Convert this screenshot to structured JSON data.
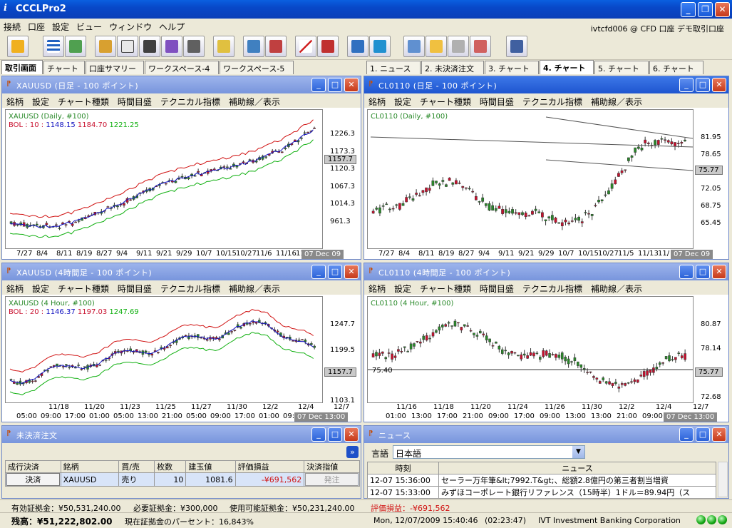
{
  "app": {
    "title": "CCCLPro2",
    "icon_glyph": "i",
    "account": "ivtcfd006 @ CFD 口座 デモ取引口座"
  },
  "menu": [
    "接続",
    "口座",
    "設定",
    "ビュー",
    "ウィンドウ",
    "ヘルプ"
  ],
  "left_tabs": [
    {
      "label": "取引画面",
      "active": true
    },
    {
      "label": "チャート"
    },
    {
      "label": "口座サマリー"
    },
    {
      "label": "ワークスペース-4"
    },
    {
      "label": "ワークスペース-5"
    }
  ],
  "right_tabs": [
    {
      "label": "1. ニュース"
    },
    {
      "label": "2. 未決済注文"
    },
    {
      "label": "3. チャート"
    },
    {
      "label": "4. チャート",
      "active": true
    },
    {
      "label": "5. チャート"
    },
    {
      "label": "6. チャート"
    }
  ],
  "chart_menu": [
    "銘柄",
    "設定",
    "チャート種類",
    "時間目盛",
    "テクニカル指標",
    "補助線／表示"
  ],
  "colors": {
    "up": "#2a8a2a",
    "down": "#c8102e",
    "bol_upper": "#d01010",
    "bol_mid": "#1010c0",
    "bol_lower": "#10b010"
  },
  "charts": [
    {
      "id": "c1",
      "title": "XAUUSD (日足 - 100 ポイント)",
      "legend": "XAUUSD (Daily, #100)",
      "bol_label": "BOL : 10 :",
      "bol_vals": [
        "1148.15",
        "1184.70",
        "1221.25"
      ],
      "yticks": [
        "1226.3",
        "1173.3",
        "1120.3",
        "1067.3",
        "1014.3",
        "961.3"
      ],
      "ylast": "1157.7",
      "xticks": [
        "7/27",
        "8/4",
        "8/11",
        "8/19",
        "8/27",
        "9/4",
        "9/11",
        "9/21",
        "9/29",
        "10/7",
        "10/15",
        "10/27",
        "11/6",
        "11/16",
        "11/"
      ],
      "date": "07 Dec 09"
    },
    {
      "id": "c2",
      "title": "CL0110 (日足 - 100 ポイント)",
      "legend": "CL0110 (Daily, #100)",
      "yticks": [
        "81.95",
        "78.65",
        "75.77",
        "72.05",
        "68.75",
        "65.45"
      ],
      "ylast": "75.77",
      "xticks": [
        "7/27",
        "8/4",
        "8/11",
        "8/19",
        "8/27",
        "9/4",
        "9/11",
        "9/21",
        "9/29",
        "10/7",
        "10/15",
        "10/27",
        "11/5",
        "11/13",
        "11/"
      ],
      "date": "07 Dec 09"
    },
    {
      "id": "c3",
      "title": "XAUUSD (4時間足 - 100 ポイント)",
      "legend": "XAUUSD (4 Hour, #100)",
      "bol_label": "BOL : 20 :",
      "bol_vals": [
        "1146.37",
        "1197.03",
        "1247.69"
      ],
      "yticks": [
        "1247.7",
        "1199.5",
        "1157.7",
        "1103.1"
      ],
      "ylast": "1157.7",
      "xticks1": [
        "11/18",
        "11/20",
        "11/23",
        "11/25",
        "11/27",
        "11/30",
        "12/2",
        "12/4",
        "12/7"
      ],
      "xticks2": [
        "05:00",
        "09:00",
        "17:00",
        "01:00",
        "05:00",
        "13:00",
        "21:00",
        "05:00",
        "09:00",
        "17:00",
        "01:00",
        "09:00",
        "13:00"
      ],
      "date": "07 Dec 13:00"
    },
    {
      "id": "c4",
      "title": "CL0110 (4時間足 - 100 ポイント)",
      "legend": "CL0110 (4 Hour, #100)",
      "hline": "75.40",
      "yticks": [
        "80.87",
        "78.14",
        "75.77",
        "72.68"
      ],
      "ylast": "75.77",
      "xticks1": [
        "11/16",
        "11/18",
        "11/20",
        "11/24",
        "11/26",
        "11/30",
        "12/2",
        "12/4",
        "12/7"
      ],
      "xticks2": [
        "01:00",
        "13:00",
        "17:00",
        "21:00",
        "09:00",
        "17:00",
        "09:00",
        "13:00",
        "13:00",
        "21:00",
        "09:00"
      ],
      "date": "07 Dec 13:00"
    }
  ],
  "orders": {
    "title": "未決済注文",
    "headers": [
      "成行決済",
      "銘柄",
      "買/売",
      "枚数",
      "建玉値",
      "評価損益",
      "決済指値"
    ],
    "row": {
      "button": "決済",
      "symbol": "XAUUSD",
      "side": "売り",
      "qty": "10",
      "price": "1081.6",
      "pnl": "-¥691,562",
      "limit_button": "発注"
    }
  },
  "news": {
    "title": "ニュース",
    "lang_label": "言語",
    "lang_value": "日本語",
    "headers": [
      "時刻",
      "ニュース"
    ],
    "rows": [
      {
        "time": "12-07 15:36:00",
        "text": "セーラー万年筆&lt;7992.T&gt;、総額2.8億円の第三者割当増資"
      },
      {
        "time": "12-07 15:33:00",
        "text": "みずほコーポレート銀行リファレンス（15時半）1ドル＝89.94円（ス"
      }
    ]
  },
  "status": {
    "margin": "有効証拠金：¥50,531,240.00",
    "required": "必要証拠金：¥300,000",
    "usable": "使用可能証拠金：¥50,231,240.00",
    "pnl": "評価損益：-¥691,562",
    "balance": "残高：¥51,222,802.00",
    "percent": "現在証拠金のパーセント：16,843%",
    "datetime": "Mon, 12/07/2009 15:40:46",
    "elapsed": "(02:23:47)",
    "company": "IVT Investment Banking Corporation"
  }
}
